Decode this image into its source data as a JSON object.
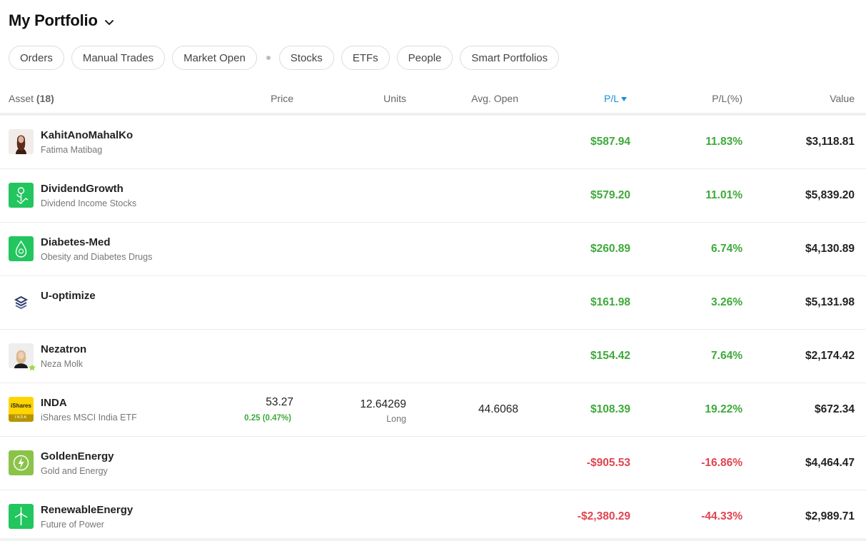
{
  "header": {
    "title": "My Portfolio",
    "dropdown_icon": "chevron-down-icon"
  },
  "filters": [
    {
      "label": "Orders"
    },
    {
      "label": "Manual Trades"
    },
    {
      "label": "Market Open"
    },
    {
      "label": "Stocks"
    },
    {
      "label": "ETFs"
    },
    {
      "label": "People"
    },
    {
      "label": "Smart Portfolios"
    }
  ],
  "table": {
    "columns": {
      "asset": "Asset",
      "asset_count": "(18)",
      "price": "Price",
      "units": "Units",
      "avg_open": "Avg. Open",
      "pl": "P/L",
      "pl_pct": "P/L(%)",
      "value": "Value"
    },
    "sort": {
      "column": "P/L",
      "direction": "desc"
    },
    "rows": [
      {
        "name": "KahitAnoMahalKo",
        "sub": "Fatima Matibag",
        "price": "",
        "price_change": "",
        "units": "",
        "direction": "",
        "avg_open": "",
        "pl": "$587.94",
        "pl_pct": "11.83%",
        "value": "$3,118.81",
        "trend": "positive",
        "avatar": "person-photo"
      },
      {
        "name": "DividendGrowth",
        "sub": "Dividend Income Stocks",
        "price": "",
        "price_change": "",
        "units": "",
        "direction": "",
        "avg_open": "",
        "pl": "$579.20",
        "pl_pct": "11.01%",
        "value": "$5,839.20",
        "trend": "positive",
        "avatar": "dividend-plant-icon"
      },
      {
        "name": "Diabetes-Med",
        "sub": "Obesity and Diabetes Drugs",
        "price": "",
        "price_change": "",
        "units": "",
        "direction": "",
        "avg_open": "",
        "pl": "$260.89",
        "pl_pct": "6.74%",
        "value": "$4,130.89",
        "trend": "positive",
        "avatar": "blood-drop-icon"
      },
      {
        "name": "U-optimize",
        "sub": "",
        "price": "",
        "price_change": "",
        "units": "",
        "direction": "",
        "avg_open": "",
        "pl": "$161.98",
        "pl_pct": "3.26%",
        "value": "$5,131.98",
        "trend": "positive",
        "avatar": "u-optimize-logo"
      },
      {
        "name": "Nezatron",
        "sub": "Neza Molk",
        "price": "",
        "price_change": "",
        "units": "",
        "direction": "",
        "avg_open": "",
        "pl": "$154.42",
        "pl_pct": "7.64%",
        "value": "$2,174.42",
        "trend": "positive",
        "avatar": "person-photo"
      },
      {
        "name": "INDA",
        "sub": "iShares MSCI India ETF",
        "price": "53.27",
        "price_change": "0.25 (0.47%)",
        "units": "12.64269",
        "direction": "Long",
        "avg_open": "44.6068",
        "pl": "$108.39",
        "pl_pct": "19.22%",
        "value": "$672.34",
        "trend": "positive",
        "avatar": "ishares-logo",
        "logo_text": "iShares",
        "logo_sub": "INDA"
      },
      {
        "name": "GoldenEnergy",
        "sub": "Gold and Energy",
        "price": "",
        "price_change": "",
        "units": "",
        "direction": "",
        "avg_open": "",
        "pl": "-$905.53",
        "pl_pct": "-16.86%",
        "value": "$4,464.47",
        "trend": "negative",
        "avatar": "lightning-icon"
      },
      {
        "name": "RenewableEnergy",
        "sub": "Future of Power",
        "price": "",
        "price_change": "",
        "units": "",
        "direction": "",
        "avg_open": "",
        "pl": "-$2,380.29",
        "pl_pct": "-44.33%",
        "value": "$2,989.71",
        "trend": "negative",
        "avatar": "wind-turbine-icon"
      }
    ]
  },
  "colors": {
    "positive": "#3daa3a",
    "negative": "#e0444f",
    "sort_accent": "#1a8fd6",
    "smart_green": "#22c55e"
  }
}
